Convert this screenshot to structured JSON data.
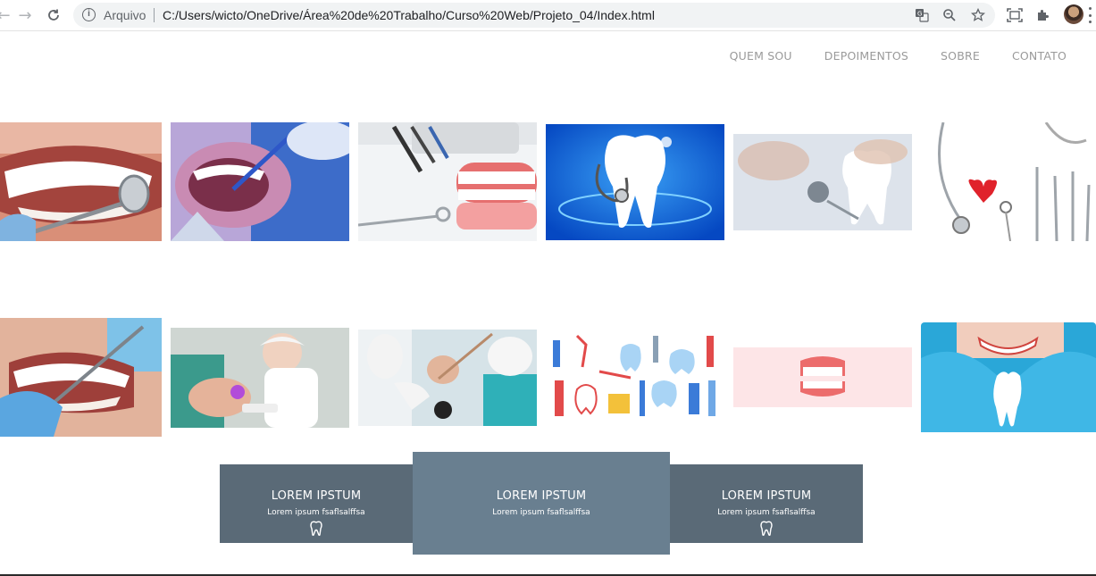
{
  "browser": {
    "scheme_label": "Arquivo",
    "url": "C:/Users/wicto/OneDrive/Área%20de%20Trabalho/Curso%20Web/Projeto_04/Index.html",
    "icons": {
      "back": "arrow-left-icon",
      "forward": "arrow-right-icon",
      "reload": "reload-icon",
      "info": "info-icon",
      "translate": "translate-icon",
      "zoom": "zoom-icon",
      "bookmark": "star-icon",
      "screenshot": "capture-icon",
      "extensions": "puzzle-icon"
    }
  },
  "nav": {
    "items": [
      {
        "label": "QUEM SOU"
      },
      {
        "label": "DEPOIMENTOS"
      },
      {
        "label": "SOBRE"
      },
      {
        "label": "CONTATO"
      }
    ]
  },
  "gallery": {
    "row1": [
      {
        "subject": "smile with dental mirror"
      },
      {
        "subject": "dental probe in mouth"
      },
      {
        "subject": "dentures and instruments"
      },
      {
        "subject": "tooth with stethoscope"
      },
      {
        "subject": "tooth model and mirror"
      },
      {
        "subject": "heart stethoscope and tools"
      }
    ],
    "row2": [
      {
        "subject": "dental exam smile"
      },
      {
        "subject": "dentist with patient"
      },
      {
        "subject": "dental procedure"
      },
      {
        "subject": "dental icons pattern"
      },
      {
        "subject": "denture illustration"
      },
      {
        "subject": "hands forming heart with tooth"
      }
    ]
  },
  "cards": [
    {
      "title": "LOREM IPSTUM",
      "text": "Lorem ipsum fsaflsalffsa",
      "icon": "tooth-icon",
      "color": "#5a6a77"
    },
    {
      "title": "LOREM IPSTUM",
      "text": "Lorem ipsum fsaflsalffsa",
      "icon": "",
      "color": "#697f90"
    },
    {
      "title": "LOREM IPSTUM",
      "text": "Lorem ipsum fsaflsalffsa",
      "icon": "tooth-icon",
      "color": "#5a6a77"
    }
  ]
}
